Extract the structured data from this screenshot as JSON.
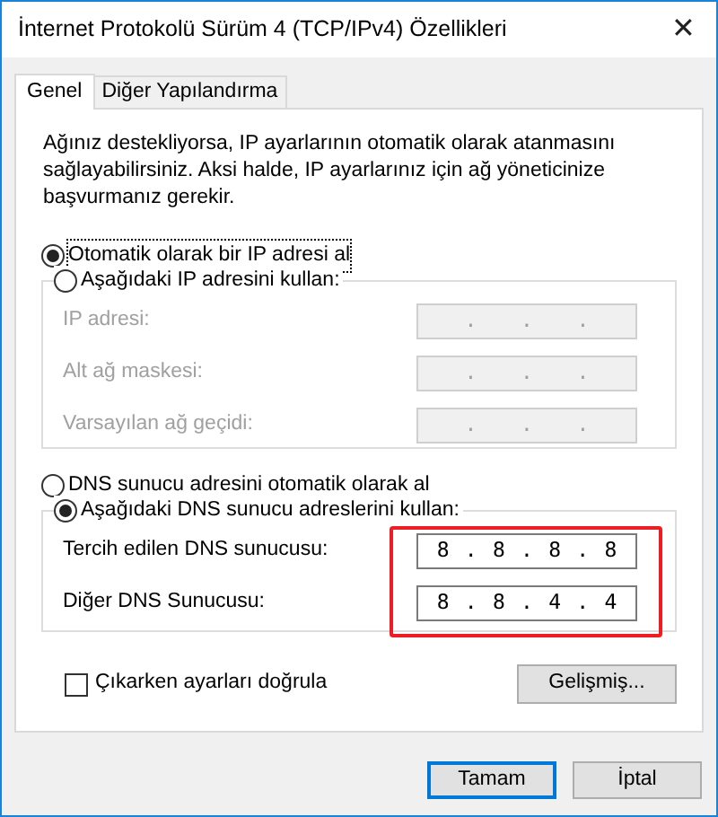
{
  "window": {
    "title": "İnternet Protokolü Sürüm 4 (TCP/IPv4) Özellikleri",
    "close": "✕"
  },
  "tabs": [
    {
      "label": "Genel",
      "selected": true
    },
    {
      "label": "Diğer Yapılandırma",
      "selected": false
    }
  ],
  "description": "Ağınız destekliyorsa, IP ayarlarının otomatik olarak atanmasını sağlayabilirsiniz. Aksi halde, IP ayarlarınız için ağ yöneticinize başvurmanız gerekir.",
  "ip_separator": ".",
  "groups": [
    {
      "options": [
        {
          "label": "Otomatik olarak bir IP adresi al",
          "selected": true,
          "focused": true
        },
        {
          "label": "Aşağıdaki IP adresini kullan:",
          "selected": false,
          "focused": false
        }
      ],
      "fields": [
        {
          "label": "IP adresi:",
          "disabled": true
        },
        {
          "label": "Alt ağ maskesi:",
          "disabled": true
        },
        {
          "label": "Varsayılan ağ geçidi:",
          "disabled": true
        }
      ]
    },
    {
      "options": [
        {
          "label": "DNS sunucu adresini otomatik olarak al",
          "selected": false,
          "focused": false
        },
        {
          "label": "Aşağıdaki DNS sunucu adreslerini kullan:",
          "selected": true,
          "focused": false
        }
      ],
      "highlighted": true,
      "fields": [
        {
          "label": "Tercih edilen DNS sunucusu:",
          "disabled": false,
          "octets": [
            "8",
            "8",
            "8",
            "8"
          ]
        },
        {
          "label": "Diğer DNS Sunucusu:",
          "disabled": false,
          "octets": [
            "8",
            "8",
            "4",
            "4"
          ]
        }
      ]
    }
  ],
  "validate": {
    "label": "Çıkarken ayarları doğrula",
    "checked": false
  },
  "advanced_button": "Gelişmiş...",
  "buttons": [
    {
      "label": "Tamam",
      "default": true
    },
    {
      "label": "İptal",
      "default": false
    }
  ]
}
